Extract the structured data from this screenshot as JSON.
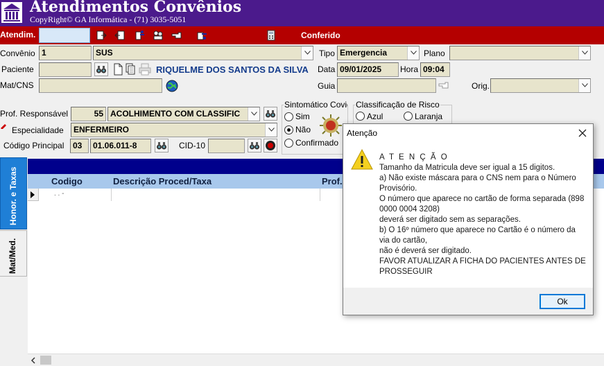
{
  "window": {
    "title": "Atendimentos Convênios",
    "copyright": "CopyRight© GA Informática - (71) 3035-5051"
  },
  "toolbar": {
    "atendim_label": "Atendim.",
    "atendim_value": "",
    "conferido_label": "Conferido"
  },
  "form": {
    "convenio": {
      "label": "Convênio",
      "code": "1",
      "name": "SUS"
    },
    "tipo": {
      "label": "Tipo",
      "value": "Emergencia"
    },
    "plano": {
      "label": "Plano",
      "value": ""
    },
    "paciente": {
      "label": "Paciente",
      "code": "",
      "name": "RIQUELME DOS SANTOS DA SILVA"
    },
    "data": {
      "label": "Data",
      "value": "09/01/2025"
    },
    "hora": {
      "label": "Hora",
      "value": "09:04"
    },
    "matcns": {
      "label": "Mat/CNS",
      "value": ""
    },
    "guia": {
      "label": "Guia",
      "value": ""
    },
    "orig": {
      "label": "Orig.",
      "value": ""
    },
    "prof_responsavel": {
      "label": "Prof. Responsável",
      "code": "55",
      "name": "ACOLHIMENTO COM CLASSIFIC"
    },
    "especialidade": {
      "label": "Especialidade",
      "value": "ENFERMEIRO"
    },
    "codigo_principal": {
      "label": "Código Principal",
      "code": "03",
      "value": "01.06.011-8"
    },
    "cid10": {
      "label": "CID-10",
      "value": ""
    },
    "sintomatico": {
      "title": "Sintomático Covid",
      "options": [
        "Sim",
        "Não",
        "Confirmado"
      ],
      "selected": "Não"
    },
    "classificacao": {
      "title": "Classificação de Risco",
      "options": [
        "Azul",
        "Laranja"
      ]
    }
  },
  "tabs": [
    "Honor. e Taxas",
    "Mat/Med."
  ],
  "grid": {
    "columns": [
      "Codigo",
      "Descrição Proced/Taxa",
      "Prof."
    ],
    "row_placeholder": ". . -"
  },
  "dialog": {
    "title": "Atenção",
    "heading": "A T E N Ç Ã O",
    "lines": [
      "Tamanho da Matricula deve ser igual a 15 digitos.",
      "a) Não existe máscara para o CNS nem para o Número Provisório.",
      "O número que aparece no cartão de forma separada (898 0000 0004 3208)",
      "deverá ser digitado sem as separações.",
      "b) O 16º número que aparece no Cartão é o número da via do cartão,",
      "não é deverá ser digitado.",
      "FAVOR ATUALIZAR A FICHA DO PACIENTES ANTES DE PROSSEGUIR"
    ],
    "ok_label": "Ok"
  },
  "colors": {
    "title_bg": "#4b1a8c",
    "toolbar_bg": "#b40000",
    "field_bg": "#e7e4cc",
    "band_blue": "#00008c",
    "tab_blue": "#1f7fd6",
    "grid_header": "#a8c8ec"
  }
}
